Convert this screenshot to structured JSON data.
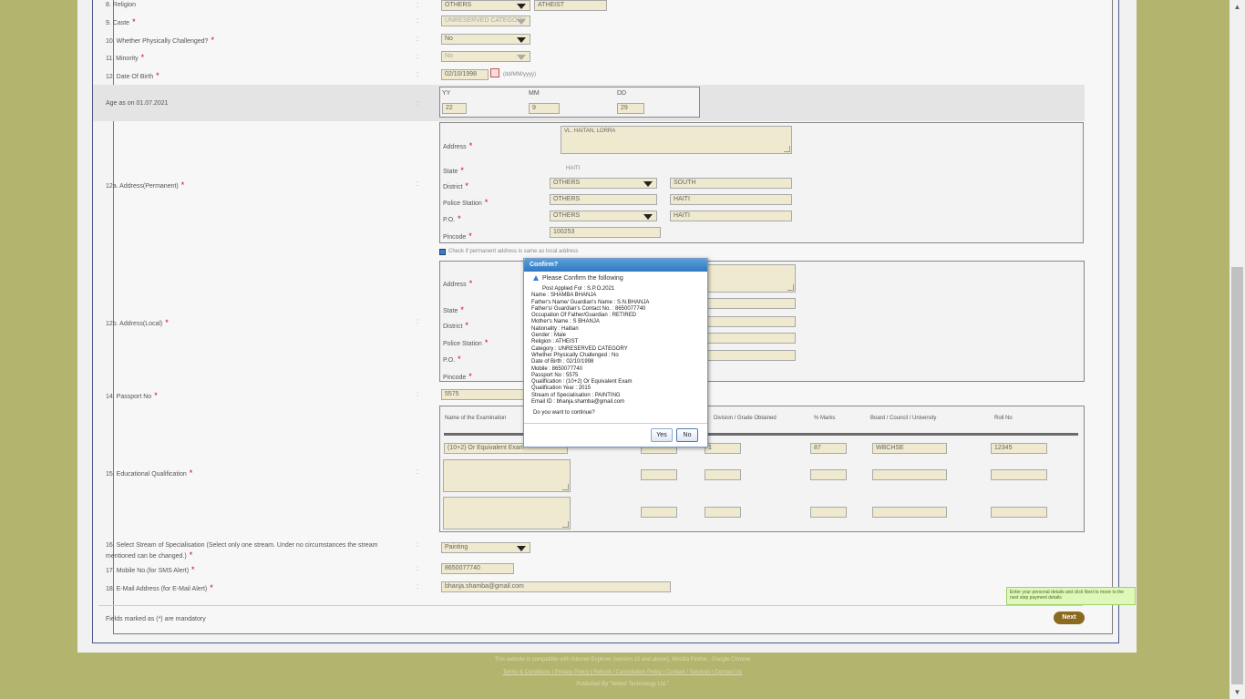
{
  "form": {
    "religion": {
      "label": "8. Religion",
      "value": "OTHERS",
      "other": "ATHEIST"
    },
    "caste": {
      "label": "9. Caste",
      "value": "UNRESERVED CATEGORY"
    },
    "physically_challenged": {
      "label": "10. Whether Physically Challenged?",
      "value": "No"
    },
    "minority": {
      "label": "11. Minority",
      "value": "No"
    },
    "dob": {
      "label": "12. Date Of Birth",
      "value": "02/10/1998",
      "hint": "(dd/MM/yyyy)"
    },
    "age": {
      "label": "Age as on 01.07.2021",
      "yy_label": "YY",
      "mm_label": "MM",
      "dd_label": "DD",
      "yy": "22",
      "mm": "9",
      "dd": "29"
    },
    "permanent": {
      "label": "12a. Address(Permanent)",
      "address_label": "Address",
      "address_value": "VL. HAITAN, LORRA",
      "state_label": "State",
      "state_value": "HAITI",
      "district_label": "District",
      "district_value": "OTHERS",
      "district_other": "SOUTH",
      "police_label": "Police Station",
      "police_value": "OTHERS",
      "police_other": "HAITI",
      "po_label": "P.O.",
      "po_value": "OTHERS",
      "po_other": "HAITI",
      "pincode_label": "Pincode",
      "pincode_value": "100253"
    },
    "same_address": "Check if permanent address is same as local address",
    "local": {
      "label": "12b. Address(Local)",
      "address_label": "Address",
      "state_label": "State",
      "district_label": "District",
      "police_label": "Police Station",
      "po_label": "P.O.",
      "pincode_label": "Pincode"
    },
    "passport": {
      "label": "14. Passport No",
      "value": "5575"
    },
    "qualification": {
      "label": "15. Educational Qualification",
      "headers": [
        "Name of the Examination",
        "Division / Grade Obtained",
        "% Marks",
        "Board / Council / University",
        "Roll No"
      ],
      "row1": {
        "exam": "(10+2) Or Equivalent Exam",
        "grade": "1",
        "marks": "87",
        "board": "WBCHSE",
        "roll": "12345"
      }
    },
    "stream": {
      "label": "16. Select Stream of Specialisation (Select only one stream. Under no circumstances the stream mentioned can be changed.)",
      "value": "Painting"
    },
    "mobile": {
      "label": "17. Mobile No.(for SMS Alert)",
      "value": "8650077740"
    },
    "email": {
      "label": "18. E-Mail Address (for E-Mail Alert)",
      "value": "bhanja.shamba@gmail.com"
    },
    "mandatory_note": "Fields marked as (*) are mandatory",
    "next_label": "Next",
    "tooltip": "Enter your personal details and click Next to move to the next step payment details"
  },
  "dialog": {
    "title": "Confirm?",
    "heading": "Please Confirm the following",
    "lines": [
      "Post Applied For : S.P.O.2021",
      "Name : SHAMBA BHANJA",
      "Father's Name/ Guardian's Name : S.N.BHANJA",
      "Father's/ Guardian's Contact No. : 8650077740",
      "Occupation Of Father/Guardian : RETIRED",
      "Mother's Name : S BHANJA",
      "Nationality : Haitian",
      "Gender : Male",
      "Religion : ATHEIST",
      "Category : UNRESERVED CATEGORY",
      "Whether Physically Challenged : No",
      "Date of Birth : 02/10/1998",
      "Mobile : 8650077740",
      "Passport No : 5575",
      "Qualification : (10+2) Or Equivalent Exam",
      "Qualification Year : 2015",
      "Stream of Specialisation : PAINTING",
      "Email ID : bhanja.shamba@gmail.com"
    ],
    "question": "Do you want to continue?",
    "yes": "Yes",
    "no": "No"
  },
  "footer": {
    "line1": "This website is compatible with Internet Explorer (version 10 and above), Mozilla Firefox , Google Chrome",
    "links": "Terms & Conditions  |  Privacy Policy  |  Refund / Cancellation Policy  |  Contact / Services  |  Contact Us",
    "line3": "Published By \"Webel Technology Ltd.\""
  }
}
